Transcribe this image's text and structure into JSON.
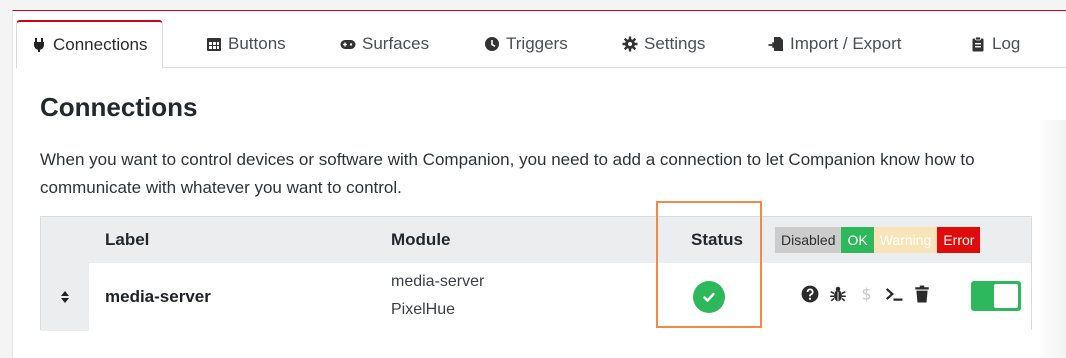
{
  "tabs": [
    {
      "label": "Connections",
      "icon": "plug-icon",
      "active": true
    },
    {
      "label": "Buttons",
      "icon": "calendar-grid-icon"
    },
    {
      "label": "Surfaces",
      "icon": "gamepad-icon"
    },
    {
      "label": "Triggers",
      "icon": "clock-icon"
    },
    {
      "label": "Settings",
      "icon": "gear-icon"
    },
    {
      "label": "Import / Export",
      "icon": "file-import-icon"
    },
    {
      "label": "Log",
      "icon": "clipboard-icon"
    }
  ],
  "page": {
    "title": "Connections",
    "description": "When you want to control devices or software with Companion, you need to add a connection to let Companion know how to communicate with whatever you want to control."
  },
  "table": {
    "headers": {
      "label": "Label",
      "module": "Module",
      "status": "Status"
    },
    "legend": {
      "disabled": "Disabled",
      "ok": "OK",
      "warning": "Warning",
      "error": "Error"
    },
    "rows": [
      {
        "label": "media-server",
        "module_name": "media-server",
        "module_sub": "PixelHue",
        "status": "ok",
        "enabled": true
      }
    ]
  },
  "colors": {
    "accent_red": "#d0021b",
    "ok_green": "#2eb85c",
    "highlight_orange": "#f08a4b"
  }
}
